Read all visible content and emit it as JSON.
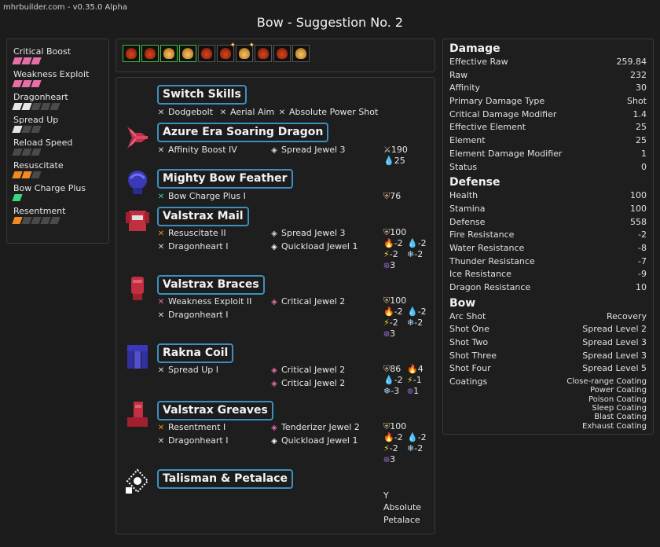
{
  "header": {
    "version": "mhrbuilder.com - v0.35.0 Alpha",
    "title": "Bow - Suggestion No. 2"
  },
  "colors": {
    "pink": "#e76ea8",
    "green": "#39d67a",
    "orange": "#f08a24",
    "gray": "#4a4a4a",
    "accent_border": "#3d8fc0",
    "selected_border": "#3ac03a"
  },
  "skills": [
    {
      "name": "Critical Boost",
      "color": "#e76ea8",
      "filled": 3,
      "total": 3
    },
    {
      "name": "Weakness Exploit",
      "color": "#e76ea8",
      "filled": 3,
      "total": 3
    },
    {
      "name": "Dragonheart",
      "color": "#e6e6e6",
      "filled": 2,
      "total": 5
    },
    {
      "name": "Spread Up",
      "color": "#e6e6e6",
      "filled": 1,
      "total": 3
    },
    {
      "name": "Reload Speed",
      "color": "#4a4a4a",
      "filled": 0,
      "total": 3
    },
    {
      "name": "Resuscitate",
      "color": "#f08a24",
      "filled": 2,
      "total": 3
    },
    {
      "name": "Bow Charge Plus",
      "color": "#39d67a",
      "filled": 1,
      "total": 1
    },
    {
      "name": "Resentment",
      "color": "#f08a24",
      "filled": 1,
      "total": 5
    }
  ],
  "decorations": [
    {
      "icon": "red-jewel-icon",
      "selected": true,
      "spark": false,
      "gold": false
    },
    {
      "icon": "red-jewel-icon",
      "selected": true,
      "spark": false,
      "gold": false
    },
    {
      "icon": "gold-jewel-icon",
      "selected": true,
      "spark": false,
      "gold": true
    },
    {
      "icon": "gold-jewel-icon",
      "selected": true,
      "spark": false,
      "gold": true
    },
    {
      "icon": "red-jewel-icon",
      "selected": false,
      "spark": false,
      "gold": false
    },
    {
      "icon": "red-jewel-icon",
      "selected": false,
      "spark": true,
      "gold": false
    },
    {
      "icon": "gold-jewel-icon",
      "selected": false,
      "spark": true,
      "gold": true
    },
    {
      "icon": "red-jewel-icon",
      "selected": false,
      "spark": false,
      "gold": false
    },
    {
      "icon": "red-jewel-icon",
      "selected": false,
      "spark": false,
      "gold": false
    },
    {
      "icon": "gold-jewel-icon",
      "selected": false,
      "spark": false,
      "gold": true
    }
  ],
  "equipment": {
    "switch_skills": {
      "name": "Switch Skills",
      "skills": [
        "Dodgebolt",
        "Aerial Aim",
        "Absolute Power Shot"
      ]
    },
    "weapon": {
      "name": "Azure Era Soaring Dragon",
      "skill": "Affinity Boost IV",
      "jewel": "Spread Jewel 3",
      "stat1": "190",
      "stat2": "25"
    },
    "head": {
      "name": "Mighty Bow Feather",
      "skill": "Bow Charge Plus I",
      "defense": "76"
    },
    "chest": {
      "name": "Valstrax Mail",
      "skill1": "Resuscitate II",
      "skill2": "Dragonheart I",
      "jewel1": "Spread Jewel 3",
      "jewel2": "Quickload Jewel 1",
      "defense": "100",
      "fire": "-2",
      "water": "-2",
      "thunder": "-2",
      "ice": "-2",
      "dragon": "3"
    },
    "arms": {
      "name": "Valstrax Braces",
      "skill1": "Weakness Exploit II",
      "skill2": "Dragonheart I",
      "jewel1": "Critical Jewel 2",
      "defense": "100",
      "fire": "-2",
      "water": "-2",
      "thunder": "-2",
      "ice": "-2",
      "dragon": "3"
    },
    "waist": {
      "name": "Rakna Coil",
      "skill1": "Spread Up I",
      "jewel1": "Critical Jewel 2",
      "jewel2": "Critical Jewel 2",
      "defense": "86",
      "fire": "4",
      "water": "-2",
      "thunder": "-1",
      "ice": "-3",
      "dragon": "1"
    },
    "legs": {
      "name": "Valstrax Greaves",
      "skill1": "Resentment I",
      "skill2": "Dragonheart I",
      "jewel1": "Tenderizer Jewel 2",
      "jewel2": "Quickload Jewel 1",
      "defense": "100",
      "fire": "-2",
      "water": "-2",
      "thunder": "-2",
      "ice": "-2",
      "dragon": "3"
    },
    "talisman": {
      "name": "Talisman & Petalace",
      "petalace_line1": "Absolute",
      "petalace_line2": "Petalace"
    }
  },
  "damage": {
    "heading": "Damage",
    "rows": [
      {
        "label": "Effective Raw",
        "value": "259.84"
      },
      {
        "label": "Raw",
        "value": "232"
      },
      {
        "label": "Affinity",
        "value": "30"
      },
      {
        "label": "Primary Damage Type",
        "value": "Shot"
      },
      {
        "label": "Critical Damage Modifier",
        "value": "1.4"
      },
      {
        "label": "Effective Element",
        "value": "25"
      },
      {
        "label": "Element",
        "value": "25"
      },
      {
        "label": "Element Damage Modifier",
        "value": "1"
      },
      {
        "label": "Status",
        "value": "0"
      }
    ]
  },
  "defense": {
    "heading": "Defense",
    "rows": [
      {
        "label": "Health",
        "value": "100"
      },
      {
        "label": "Stamina",
        "value": "100"
      },
      {
        "label": "Defense",
        "value": "558"
      },
      {
        "label": "Fire Resistance",
        "value": "-2"
      },
      {
        "label": "Water Resistance",
        "value": "-8"
      },
      {
        "label": "Thunder Resistance",
        "value": "-7"
      },
      {
        "label": "Ice Resistance",
        "value": "-9"
      },
      {
        "label": "Dragon Resistance",
        "value": "10"
      }
    ]
  },
  "bow": {
    "heading": "Bow",
    "rows": [
      {
        "label": "Arc Shot",
        "value": "Recovery"
      },
      {
        "label": "Shot One",
        "value": "Spread Level 2"
      },
      {
        "label": "Shot Two",
        "value": "Spread Level 3"
      },
      {
        "label": "Shot Three",
        "value": "Spread Level 3"
      },
      {
        "label": "Shot Four",
        "value": "Spread Level 5"
      }
    ],
    "coatings_label": "Coatings",
    "coatings": [
      "Close-range Coating",
      "Power Coating",
      "Poison Coating",
      "Sleep Coating",
      "Blast Coating",
      "Exhaust Coating"
    ]
  }
}
